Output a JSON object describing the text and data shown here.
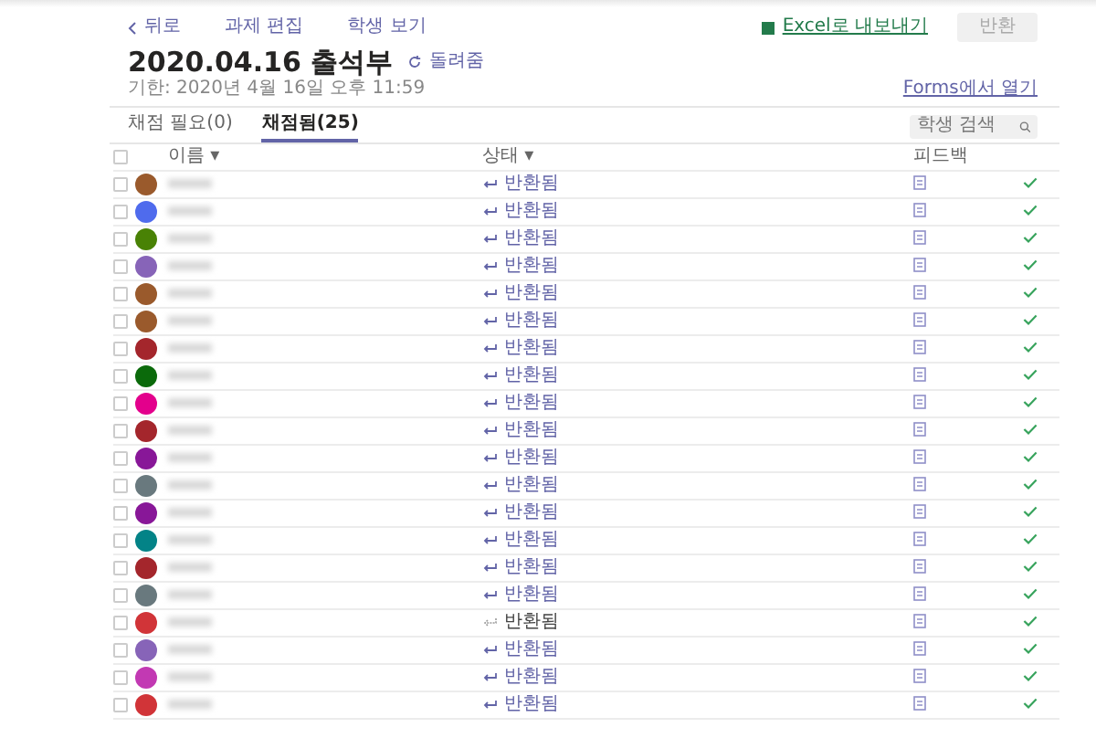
{
  "nav": [
    {
      "label": "뒤로",
      "kind": "back"
    },
    {
      "label": "과제 편집",
      "kind": "link"
    },
    {
      "label": "학생 보기",
      "kind": "link"
    }
  ],
  "export": {
    "label": "Excel로 내보내기"
  },
  "return_button": {
    "label": "반환",
    "disabled": true
  },
  "title": "2020.04.16 출석부",
  "title_action": "돌려줌",
  "due": "기한: 2020년 4월 16일 오후 11:59",
  "forms_link": "Forms에서 열기",
  "tabs": [
    {
      "label": "채점 필요(0)",
      "selected": false
    },
    {
      "label": "채점됨(25)",
      "selected": true
    }
  ],
  "search": {
    "placeholder": "학생 검색"
  },
  "select_all": {
    "checked": false
  },
  "columns": [
    "이름 ▾",
    "상태 ▾",
    "피드백"
  ],
  "rows": [
    {
      "checked": false,
      "color": "#9a5a2c",
      "status": "반환됨",
      "kind": "returned",
      "done": true
    },
    {
      "checked": false,
      "color": "#4f6bed",
      "status": "반환됨",
      "kind": "returned",
      "done": true
    },
    {
      "checked": false,
      "color": "#498205",
      "status": "반환됨",
      "kind": "returned",
      "done": true
    },
    {
      "checked": false,
      "color": "#8764b8",
      "status": "반환됨",
      "kind": "returned",
      "done": true
    },
    {
      "checked": false,
      "color": "#9a5a2c",
      "status": "반환됨",
      "kind": "returned",
      "done": true
    },
    {
      "checked": false,
      "color": "#9a5a2c",
      "status": "반환됨",
      "kind": "returned",
      "done": true
    },
    {
      "checked": false,
      "color": "#a4262c",
      "status": "반환됨",
      "kind": "returned",
      "done": true
    },
    {
      "checked": false,
      "color": "#0b6a0b",
      "status": "반환됨",
      "kind": "returned",
      "done": true
    },
    {
      "checked": false,
      "color": "#e3008c",
      "status": "반환됨",
      "kind": "returned",
      "done": true
    },
    {
      "checked": false,
      "color": "#a4262c",
      "status": "반환됨",
      "kind": "returned",
      "done": true
    },
    {
      "checked": false,
      "color": "#881798",
      "status": "반환됨",
      "kind": "returned",
      "done": true
    },
    {
      "checked": false,
      "color": "#69797e",
      "status": "반환됨",
      "kind": "returned",
      "done": true
    },
    {
      "checked": false,
      "color": "#881798",
      "status": "반환됨",
      "kind": "returned",
      "done": true
    },
    {
      "checked": false,
      "color": "#038387",
      "status": "반환됨",
      "kind": "returned",
      "done": true
    },
    {
      "checked": false,
      "color": "#a4262c",
      "status": "반환됨",
      "kind": "returned",
      "done": true
    },
    {
      "checked": false,
      "color": "#69797e",
      "status": "반환됨",
      "kind": "returned",
      "done": true
    },
    {
      "checked": false,
      "color": "#d13438",
      "status": "반환됨",
      "kind": "pending",
      "done": true
    },
    {
      "checked": false,
      "color": "#8764b8",
      "status": "반환됨",
      "kind": "returned",
      "done": true
    },
    {
      "checked": false,
      "color": "#c239b3",
      "status": "반환됨",
      "kind": "returned",
      "done": true
    },
    {
      "checked": false,
      "color": "#d13438",
      "status": "반환됨",
      "kind": "returned",
      "done": true
    }
  ]
}
